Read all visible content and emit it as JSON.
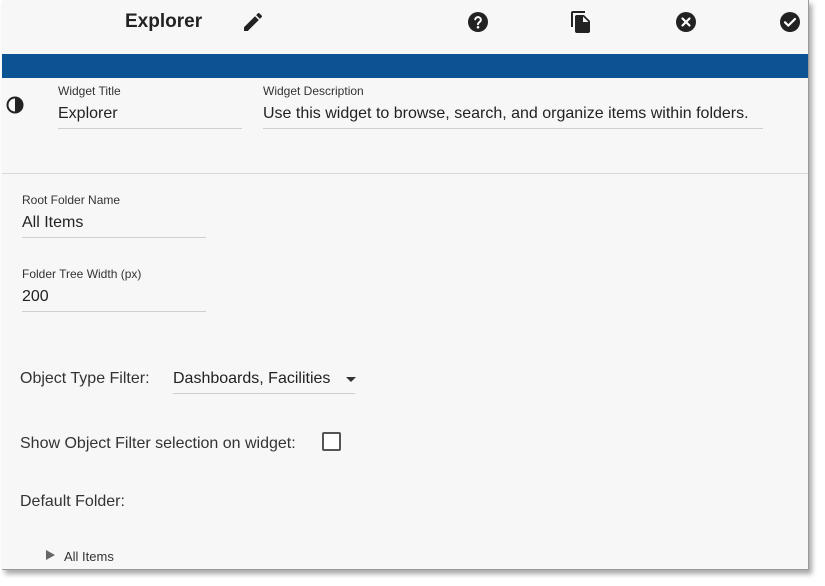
{
  "header": {
    "title": "Explorer",
    "icons": [
      "edit-icon",
      "help-icon",
      "copy-icon",
      "close-icon",
      "check-icon"
    ]
  },
  "widget": {
    "title_label": "Widget Title",
    "title_value": "Explorer",
    "description_label": "Widget Description",
    "description_value": "Use this widget to browse, search, and organize items within folders."
  },
  "settings": {
    "root_folder_label": "Root Folder Name",
    "root_folder_value": "All Items",
    "tree_width_label": "Folder Tree Width (px)",
    "tree_width_value": "200",
    "object_type_filter_label": "Object Type Filter:",
    "object_type_filter_value": "Dashboards, Facilities",
    "show_filter_label": "Show Object Filter selection on widget:",
    "show_filter_checked": false,
    "default_folder_label": "Default Folder:"
  },
  "tree": {
    "items": [
      {
        "label": "All Items"
      }
    ]
  },
  "colors": {
    "accent_bar": "#0b5393",
    "icon": "#222222"
  }
}
